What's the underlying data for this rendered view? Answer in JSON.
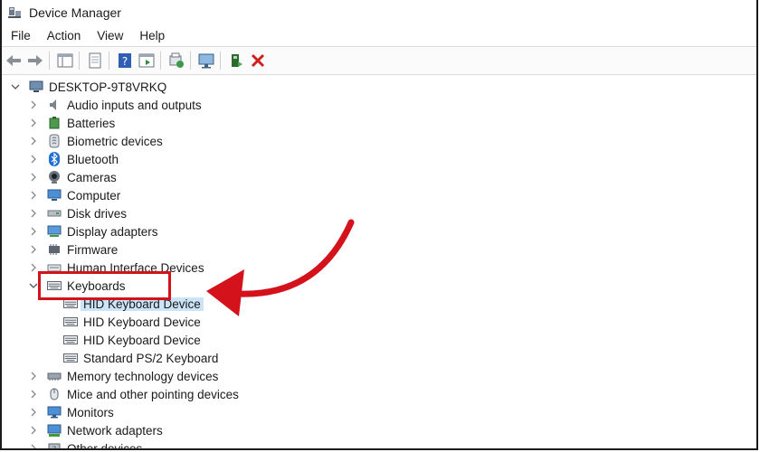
{
  "window": {
    "title": "Device Manager"
  },
  "menu": [
    "File",
    "Action",
    "View",
    "Help"
  ],
  "toolbar_icons": [
    "back-arrow-icon",
    "forward-arrow-icon",
    "properties-grid-icon",
    "show-hidden-icon",
    "help-icon",
    "action-pane-icon",
    "scan-hardware-icon",
    "monitor-icon",
    "enable-device-icon",
    "uninstall-x-icon"
  ],
  "tree": {
    "root": "DESKTOP-9T8VRKQ",
    "categories": [
      {
        "label": "Audio inputs and outputs",
        "icon": "speaker-icon",
        "expanded": false
      },
      {
        "label": "Batteries",
        "icon": "battery-icon",
        "expanded": false
      },
      {
        "label": "Biometric devices",
        "icon": "fingerprint-icon",
        "expanded": false
      },
      {
        "label": "Bluetooth",
        "icon": "bluetooth-icon",
        "expanded": false
      },
      {
        "label": "Cameras",
        "icon": "camera-icon",
        "expanded": false
      },
      {
        "label": "Computer",
        "icon": "computer-icon",
        "expanded": false
      },
      {
        "label": "Disk drives",
        "icon": "disk-drive-icon",
        "expanded": false
      },
      {
        "label": "Display adapters",
        "icon": "display-adapter-icon",
        "expanded": false
      },
      {
        "label": "Firmware",
        "icon": "firmware-icon",
        "expanded": false
      },
      {
        "label": "Human Interface Devices",
        "icon": "hid-icon",
        "expanded": false
      },
      {
        "label": "Keyboards",
        "icon": "keyboard-icon",
        "expanded": true
      },
      {
        "label": "Memory technology devices",
        "icon": "memory-icon",
        "expanded": false
      },
      {
        "label": "Mice and other pointing devices",
        "icon": "mouse-icon",
        "expanded": false
      },
      {
        "label": "Monitors",
        "icon": "monitor-icon",
        "expanded": false
      },
      {
        "label": "Network adapters",
        "icon": "network-icon",
        "expanded": false
      },
      {
        "label": "Other devices",
        "icon": "other-devices-icon",
        "expanded": false
      }
    ],
    "keyboard_children": [
      {
        "label": "HID Keyboard Device",
        "selected": true
      },
      {
        "label": "HID Keyboard Device",
        "selected": false
      },
      {
        "label": "HID Keyboard Device",
        "selected": false
      },
      {
        "label": "Standard PS/2 Keyboard",
        "selected": false
      }
    ]
  },
  "colors": {
    "highlight": "#d4121c",
    "selection": "#cce4f7"
  }
}
